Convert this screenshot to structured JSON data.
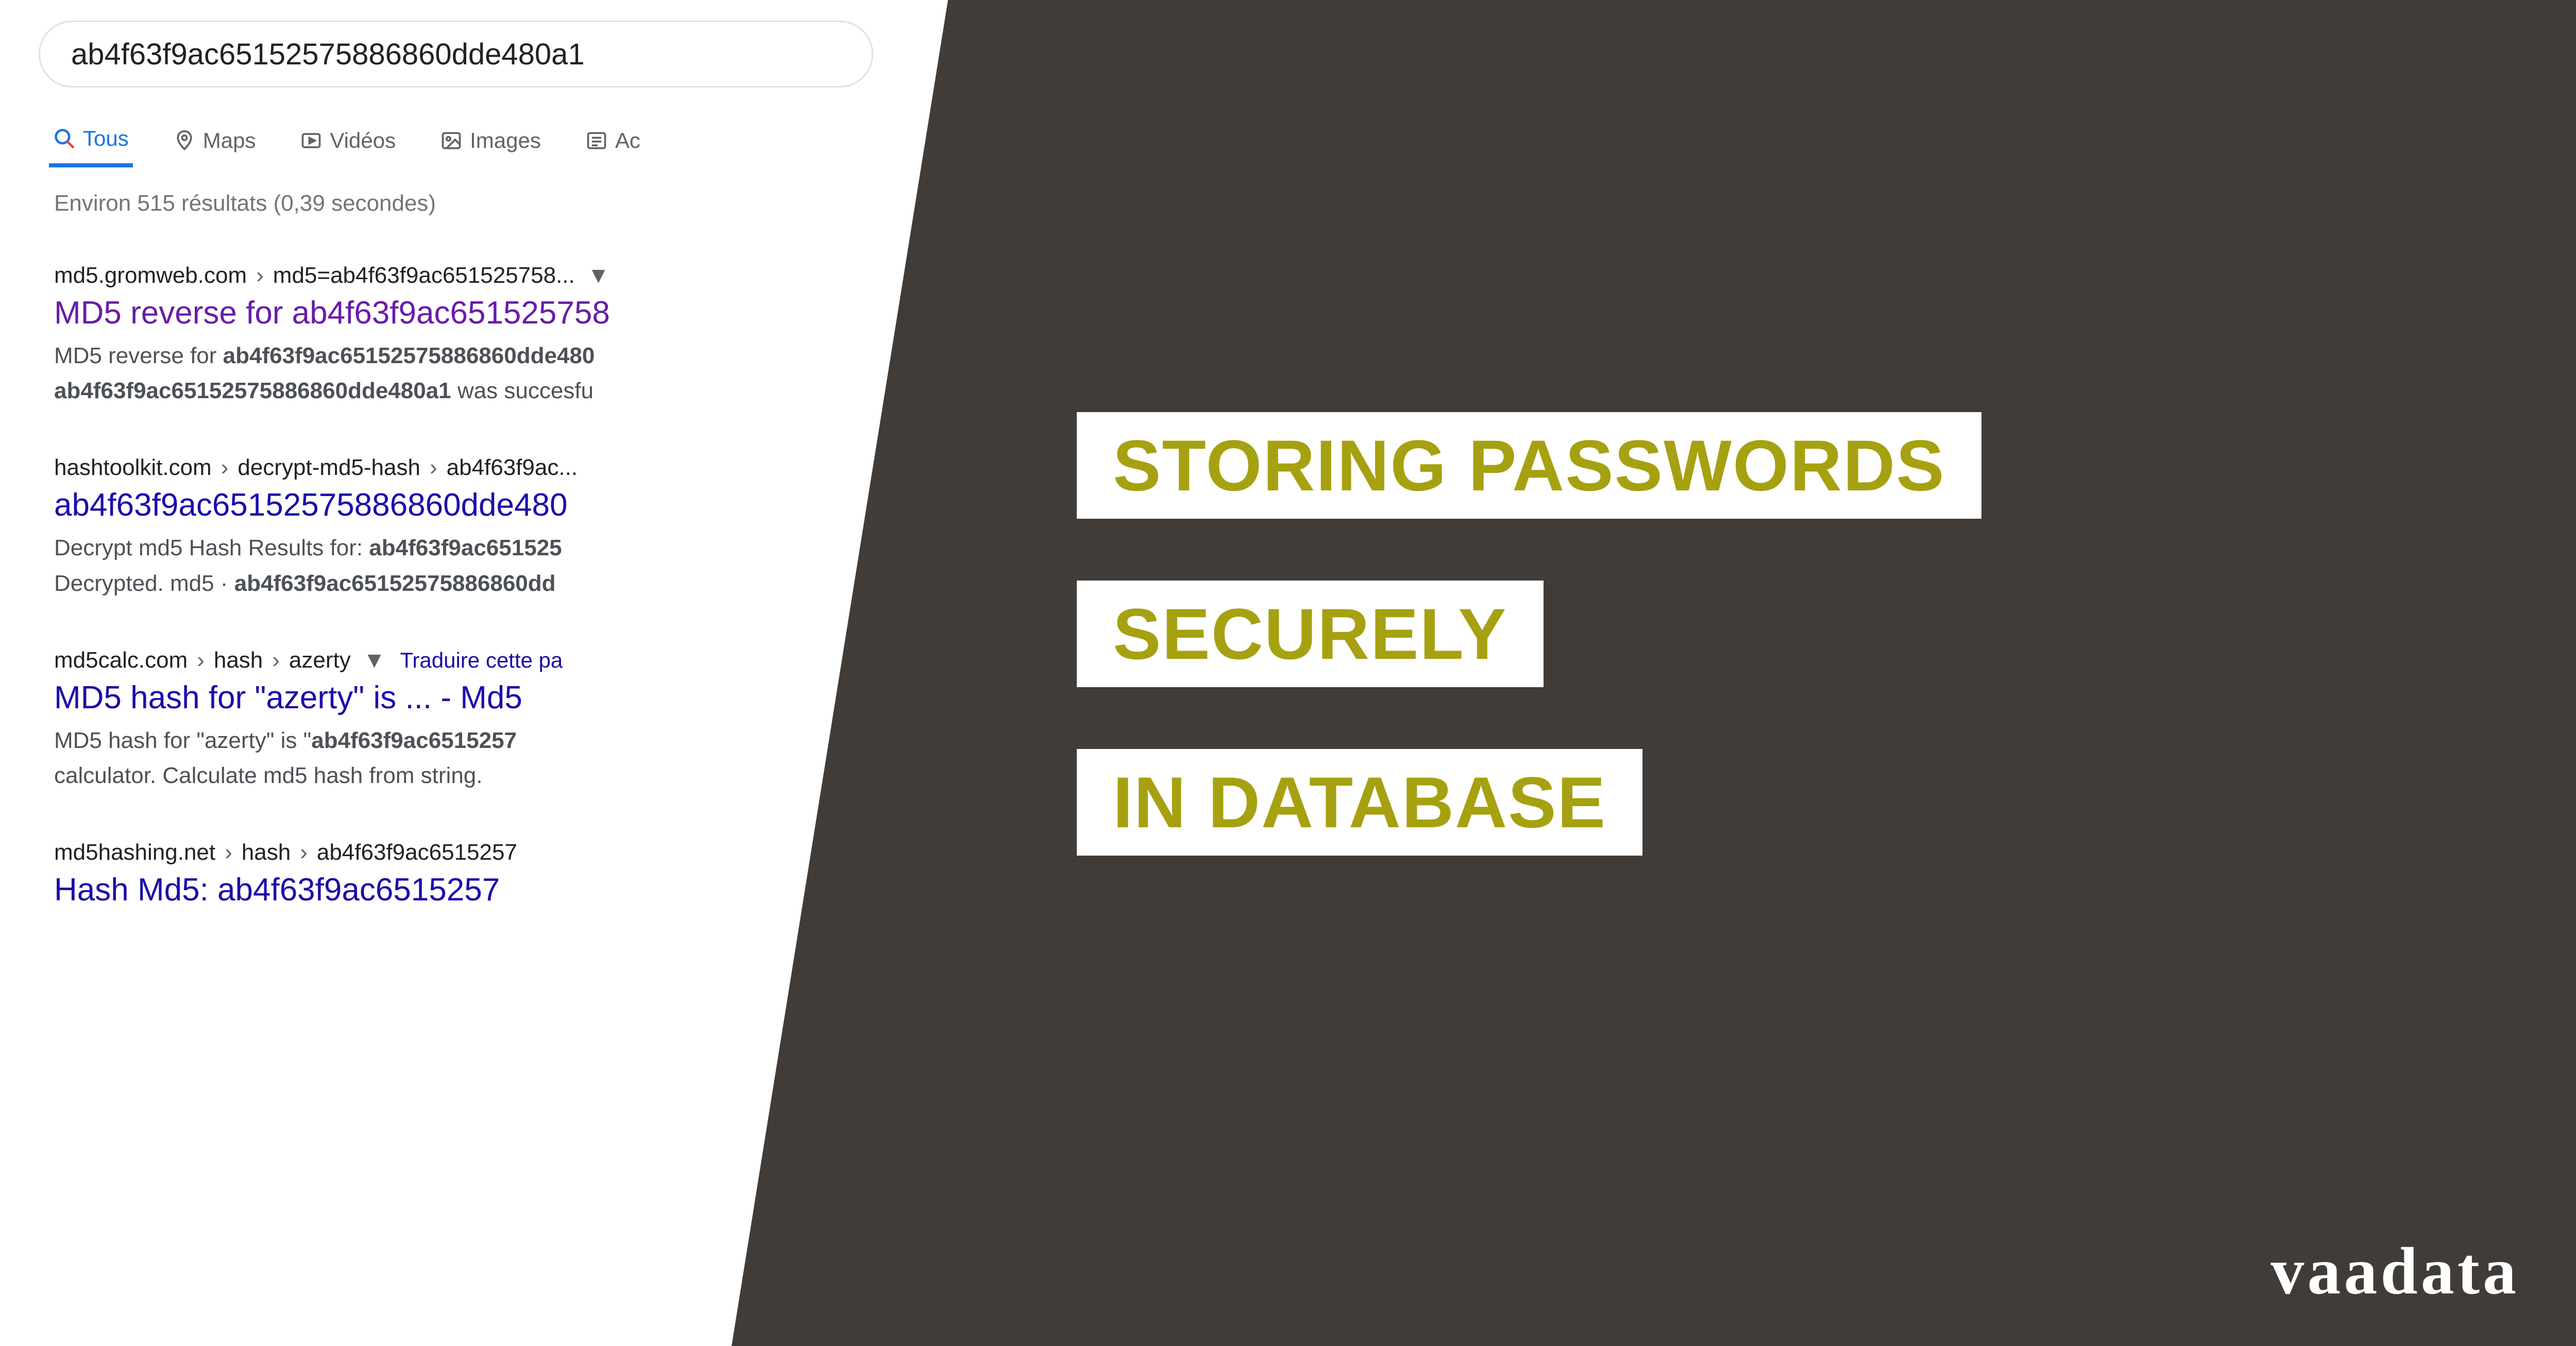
{
  "search": {
    "query": "ab4f63f9ac65152575886860dde480a1",
    "stats": "Environ 515 résultats (0,39 secondes)"
  },
  "tabs": [
    {
      "label": "Tous"
    },
    {
      "label": "Maps"
    },
    {
      "label": "Vidéos"
    },
    {
      "label": "Images"
    },
    {
      "label": "Ac"
    }
  ],
  "results": [
    {
      "bc1": "md5.gromweb.com",
      "bc2": "md5=ab4f63f9ac651525758...",
      "title": "MD5 reverse for ab4f63f9ac651525758",
      "snip1a": "MD5 reverse for ",
      "snip1b": "ab4f63f9ac65152575886860dde480",
      "snip2a": "ab4f63f9ac65152575886860dde480a1",
      "snip2b": " was succesfu"
    },
    {
      "bc1": "hashtoolkit.com",
      "bc2": "decrypt-md5-hash",
      "bc3": "ab4f63f9ac...",
      "title": "ab4f63f9ac65152575886860dde480",
      "snip1a": "Decrypt md5 Hash Results for: ",
      "snip1b": "ab4f63f9ac651525",
      "snip2a": "Decrypted. md5 · ",
      "snip2b": "ab4f63f9ac65152575886860dd"
    },
    {
      "bc1": "md5calc.com",
      "bc2": "hash",
      "bc3": "azerty",
      "translate": "Traduire cette pa",
      "title": "MD5 hash for \"azerty\" is ... - Md5",
      "snip1a": "MD5 hash for \"azerty\" is \"",
      "snip1b": "ab4f63f9ac6515257",
      "snip2a": "calculator. Calculate md5 hash from string.",
      "snip2b": ""
    },
    {
      "bc1": "md5hashing.net",
      "bc2": "hash",
      "bc3": "ab4f63f9ac6515257",
      "title": "Hash Md5: ab4f63f9ac6515257"
    }
  ],
  "headline": {
    "line1": "STORING PASSWORDS",
    "line2": "SECURELY",
    "line3": "IN DATABASE"
  },
  "brand": "vaadata"
}
